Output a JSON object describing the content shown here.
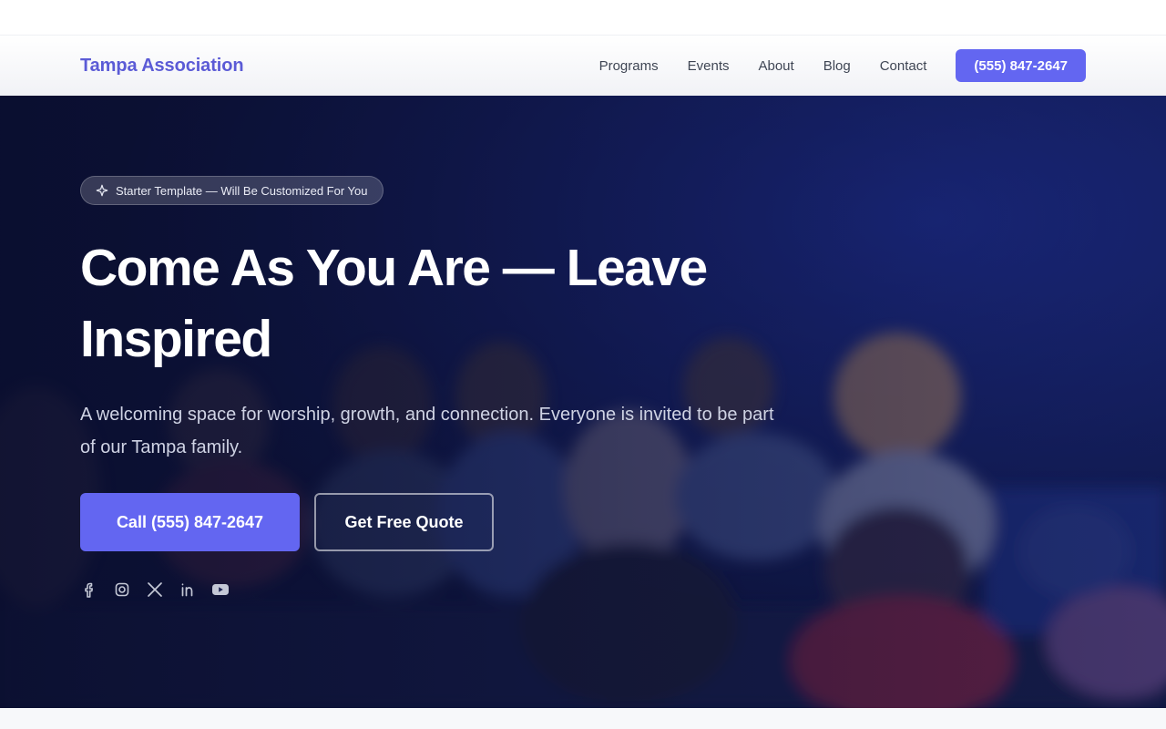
{
  "header": {
    "brand": "Tampa Association",
    "nav": [
      "Programs",
      "Events",
      "About",
      "Blog",
      "Contact"
    ],
    "cta_label": "(555) 847-2647"
  },
  "hero": {
    "badge": "Starter Template — Will Be Customized For You",
    "title": "Come As You Are — Leave Inspired",
    "subtitle": "A welcoming space for worship, growth, and connection. Everyone is invited to be part of our Tampa family.",
    "primary_cta": "Call (555) 847-2647",
    "secondary_cta": "Get Free Quote",
    "social_icons": [
      "facebook-icon",
      "instagram-icon",
      "x-icon",
      "linkedin-icon",
      "youtube-icon"
    ]
  },
  "colors": {
    "accent": "#6366f1",
    "brand": "#5b5bd6",
    "hero_overlay": "#0f1538"
  }
}
